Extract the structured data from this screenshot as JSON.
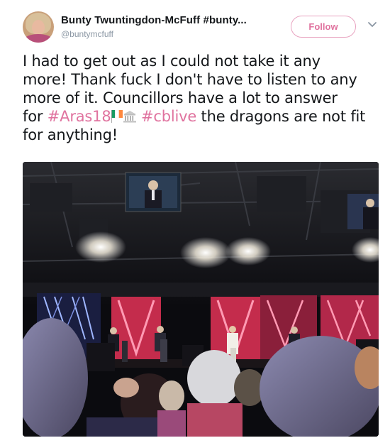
{
  "tweet": {
    "author_name": "Bunty Twuntingdon-McFuff #bunty...",
    "author_handle": "@buntymcfuff",
    "follow_label": "Follow",
    "lines": [
      {
        "text": "I had to get out as I could not take it any"
      },
      {
        "text": "more! Thank fuck I don't have to listen to any"
      },
      {
        "text": "more of it. Councillors have a lot to answer"
      },
      {
        "pre": "for ",
        "hashtag1": "#Aras18",
        "mid": " ",
        "hashtag2": "#cblive",
        "post": " the dragons are not fit"
      },
      {
        "text": "for anything!"
      }
    ]
  },
  "icons": {
    "chevron": "chevron-down-icon",
    "flag": "ireland-flag-emoji",
    "building": "classical-building-emoji"
  },
  "colors": {
    "accent": "#e0739f",
    "follow_border": "#e8a3c0",
    "text": "#14171a",
    "muted": "#8a96a3"
  }
}
